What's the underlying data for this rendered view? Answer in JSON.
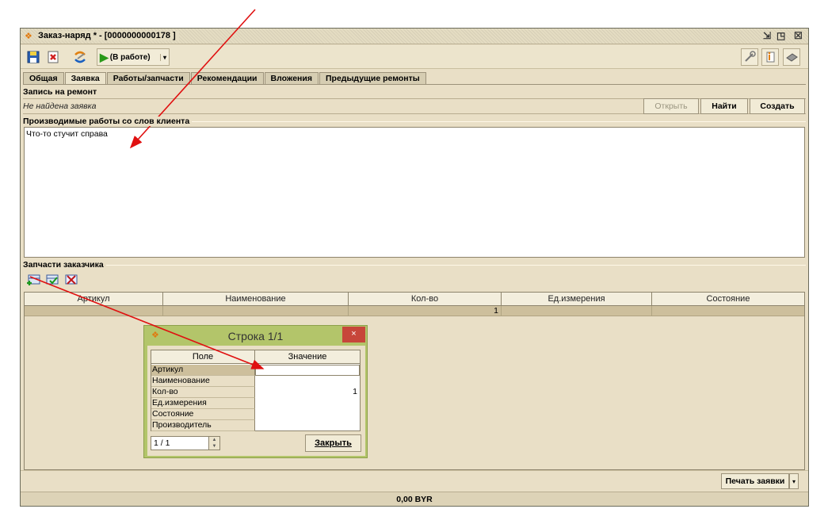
{
  "window": {
    "title": "Заказ-наряд * - [0000000000178 ]",
    "controls": [
      "restore-icon",
      "maximize-icon",
      "close-icon"
    ]
  },
  "toolbar": {
    "status_label": "(В работе)",
    "icons_left": [
      "save-icon",
      "cancel-icon",
      "refresh-icon"
    ],
    "icons_right": [
      "tools-icon",
      "info-icon",
      "printer-icon"
    ]
  },
  "tabs": [
    {
      "label": "Общая",
      "active": false
    },
    {
      "label": "Заявка",
      "active": true
    },
    {
      "label": "Работы/запчасти",
      "active": false
    },
    {
      "label": "Рекомендации",
      "active": false
    },
    {
      "label": "Вложения",
      "active": false
    },
    {
      "label": "Предыдущие ремонты",
      "active": false
    }
  ],
  "request": {
    "section_title": "Запись на ремонт",
    "status_text": "Не найдена заявка",
    "open_label": "Открыть",
    "find_label": "Найти",
    "create_label": "Создать"
  },
  "works": {
    "section_title": "Производимые работы со слов клиента",
    "text": "Что-то стучит справа"
  },
  "parts": {
    "section_title": "Запчасти заказчика",
    "columns": [
      "Артикул",
      "Наименование",
      "Кол-во",
      "Ед.измерения",
      "Состояние"
    ],
    "rows": [
      {
        "article": "",
        "name": "",
        "qty": "1",
        "unit": "",
        "state": ""
      }
    ]
  },
  "footer": {
    "print_label": "Печать заявки",
    "total": "0,00 BYR"
  },
  "dialog": {
    "title": "Строка 1/1",
    "col_field": "Поле",
    "col_value": "Значение",
    "rows": [
      {
        "field": "Артикул",
        "value": ""
      },
      {
        "field": "Наименование",
        "value": ""
      },
      {
        "field": "Кол-во",
        "value": "1"
      },
      {
        "field": "Ед.измерения",
        "value": ""
      },
      {
        "field": "Состояние",
        "value": ""
      },
      {
        "field": "Производитель",
        "value": ""
      }
    ],
    "pager": "1 / 1",
    "close_label": "Закрыть",
    "close_x": "×"
  },
  "colors": {
    "annotation_arrow": "#e01010",
    "dialog_frame": "#b3c56a",
    "window_bg": "#e9dfc6"
  }
}
